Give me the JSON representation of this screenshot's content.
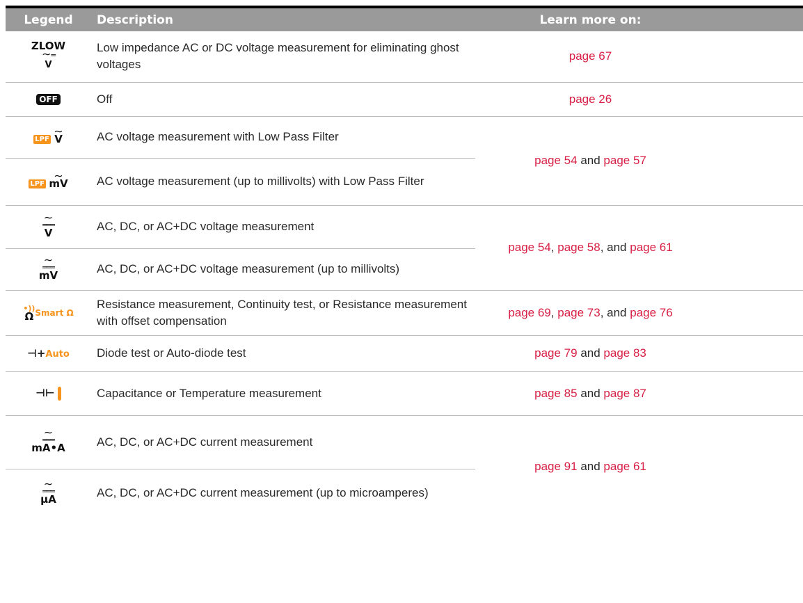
{
  "headers": {
    "legend": "Legend",
    "description": "Description",
    "learn": "Learn more on:"
  },
  "rows": [
    {
      "icon": "zlow-voltage-icon",
      "icon_text": "ZLOW",
      "icon_unit": "V",
      "description": "Low impedance AC or DC voltage measurement for eliminating ghost voltages",
      "pages": [
        "page 67"
      ]
    },
    {
      "icon": "off-icon",
      "icon_text": "OFF",
      "description": "Off",
      "pages": [
        "page 26"
      ]
    },
    {
      "icon": "lpf-ac-voltage-icon",
      "icon_text": "LPF",
      "icon_unit": "V",
      "description": "AC voltage measurement with Low Pass Filter"
    },
    {
      "icon": "lpf-ac-millivolt-icon",
      "icon_text": "LPF",
      "icon_unit": "mV",
      "description": "AC voltage measurement (up to millivolts) with Low Pass Filter"
    },
    {
      "icon": "acdc-voltage-icon",
      "icon_unit": "V",
      "description": "AC, DC, or AC+DC voltage measurement"
    },
    {
      "icon": "acdc-millivolt-icon",
      "icon_unit": "mV",
      "description": "AC, DC, or AC+DC voltage measurement (up to millivolts)"
    },
    {
      "icon": "resistance-smart-ohm-icon",
      "icon_text": "Smart Ω",
      "icon_unit": "Ω",
      "description": "Resistance measurement, Continuity test, or Resistance measurement with offset compensation",
      "pages": [
        "page 69",
        "page 73",
        "page 76"
      ]
    },
    {
      "icon": "diode-auto-icon",
      "icon_text": "Auto",
      "description": "Diode test or Auto-diode test",
      "pages": [
        "page 79",
        "page 83"
      ]
    },
    {
      "icon": "capacitance-temperature-icon",
      "description": "Capacitance or Temperature measurement",
      "pages": [
        "page 85",
        "page 87"
      ]
    },
    {
      "icon": "acdc-current-icon",
      "icon_unit": "mA•A",
      "description": "AC, DC, or AC+DC current measurement"
    },
    {
      "icon": "acdc-microamp-icon",
      "icon_unit": "μA",
      "description": "AC, DC, or AC+DC current measurement (up to microamperes)"
    }
  ],
  "groups": {
    "lpf": [
      "page 54",
      "page 57"
    ],
    "voltage": [
      "page 54",
      "page 58",
      "page 61"
    ],
    "current": [
      "page 91",
      "page 61"
    ]
  },
  "connectors": {
    "and": "and",
    "comma": ",",
    "comma_and": ", and"
  },
  "colors": {
    "header_bg": "#9a9a9a",
    "link": "#d81f44",
    "accent": "#f7941d"
  }
}
